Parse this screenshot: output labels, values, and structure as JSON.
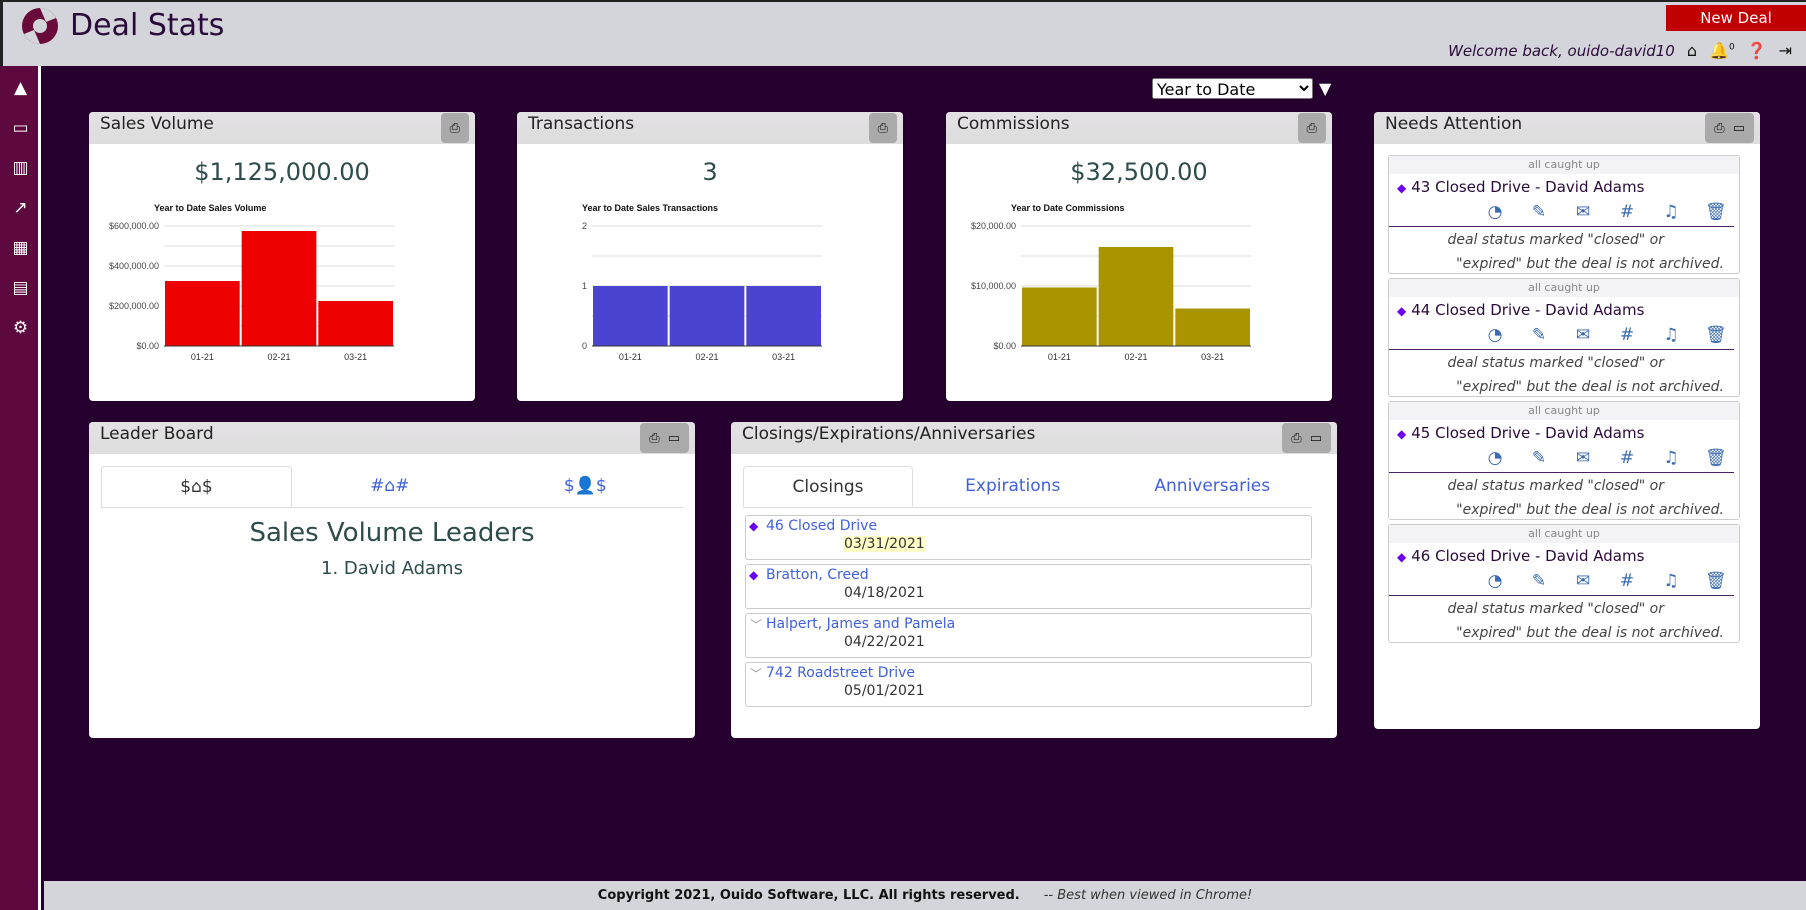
{
  "header": {
    "title": "Deal Stats",
    "new_deal": "New Deal",
    "welcome": "Welcome back, ouido-david10",
    "notifications": "0",
    "icons": [
      "home-icon",
      "bell-icon",
      "question-icon",
      "sign-out-icon"
    ]
  },
  "sidebar": {
    "items": [
      "rocket-icon",
      "desktop-icon",
      "map-icon",
      "chart-line-icon",
      "calendar-icon",
      "id-card-icon",
      "cogs-icon"
    ]
  },
  "filter": {
    "selected": "Year to Date"
  },
  "colors": {
    "sales": "#ee0000",
    "transactions": "#4b44d0",
    "commissions": "#aa9400",
    "sidebar": "#5e0840",
    "background": "#25002e"
  },
  "cards": {
    "sales": {
      "title": "Sales Volume",
      "total": "$1,125,000.00"
    },
    "transactions": {
      "title": "Transactions",
      "total": "3"
    },
    "commissions": {
      "title": "Commissions",
      "total": "$32,500.00"
    }
  },
  "chart_data": [
    {
      "type": "bar",
      "title": "Year to Date Sales Volume",
      "categories": [
        "01-21",
        "02-21",
        "03-21"
      ],
      "values": [
        325000,
        575000,
        225000
      ],
      "ylim": [
        0,
        600000
      ],
      "yticks": [
        "$0.00",
        "$200,000.00",
        "$400,000.00",
        "$600,000.00"
      ],
      "tickvals": [
        0,
        200000,
        400000,
        600000
      ],
      "grid": true
    },
    {
      "type": "bar",
      "title": "Year to Date Sales Transactions",
      "categories": [
        "01-21",
        "02-21",
        "03-21"
      ],
      "values": [
        1,
        1,
        1
      ],
      "ylim": [
        0,
        2
      ],
      "yticks": [
        "0",
        "1",
        "2"
      ],
      "tickvals": [
        0,
        1,
        2
      ],
      "grid": true
    },
    {
      "type": "bar",
      "title": "Year to Date Commissions",
      "categories": [
        "01-21",
        "02-21",
        "03-21"
      ],
      "values": [
        9750,
        16500,
        6250
      ],
      "ylim": [
        0,
        20000
      ],
      "yticks": [
        "$0.00",
        "$10,000.00",
        "$20,000.00"
      ],
      "tickvals": [
        0,
        10000,
        20000
      ],
      "grid": true
    }
  ],
  "leader": {
    "title": "Leader Board",
    "tabs": [
      {
        "pre": "$",
        "post": "$",
        "icon": "home-icon"
      },
      {
        "pre": "#",
        "post": "#",
        "icon": "home-icon"
      },
      {
        "pre": "$",
        "post": "$",
        "icon": "user-icon"
      }
    ],
    "heading": "Sales Volume Leaders",
    "items": [
      "1. David Adams"
    ]
  },
  "closings": {
    "title": "Closings/Expirations/Anniversaries",
    "tabs": [
      "Closings",
      "Expirations",
      "Anniversaries"
    ],
    "items": [
      {
        "name": "46 Closed Drive",
        "date": "03/31/2021",
        "marker": "diamond"
      },
      {
        "name": "Bratton, Creed",
        "date": "04/18/2021",
        "marker": "diamond"
      },
      {
        "name": "Halpert, James and Pamela",
        "date": "04/22/2021",
        "marker": "chevron"
      },
      {
        "name": "742 Roadstreet Drive",
        "date": "05/01/2021",
        "marker": "chevron"
      }
    ]
  },
  "attention": {
    "title": "Needs Attention",
    "items": [
      {
        "status": "all caught up",
        "title": "43 Closed Drive - David Adams",
        "msg1": "deal status marked \"closed\" or",
        "msg2": "\"expired\" but the deal is not archived."
      },
      {
        "status": "all caught up",
        "title": "44 Closed Drive - David Adams",
        "msg1": "deal status marked \"closed\" or",
        "msg2": "\"expired\" but the deal is not archived."
      },
      {
        "status": "all caught up",
        "title": "45 Closed Drive - David Adams",
        "msg1": "deal status marked \"closed\" or",
        "msg2": "\"expired\" but the deal is not archived."
      },
      {
        "status": "all caught up",
        "title": "46 Closed Drive - David Adams",
        "msg1": "deal status marked \"closed\" or",
        "msg2": "\"expired\" but the deal is not archived."
      }
    ]
  },
  "footer": {
    "copyright": "Copyright 2021, Ouido Software, LLC. All rights reserved.",
    "note": "-- Best when viewed in Chrome!"
  }
}
